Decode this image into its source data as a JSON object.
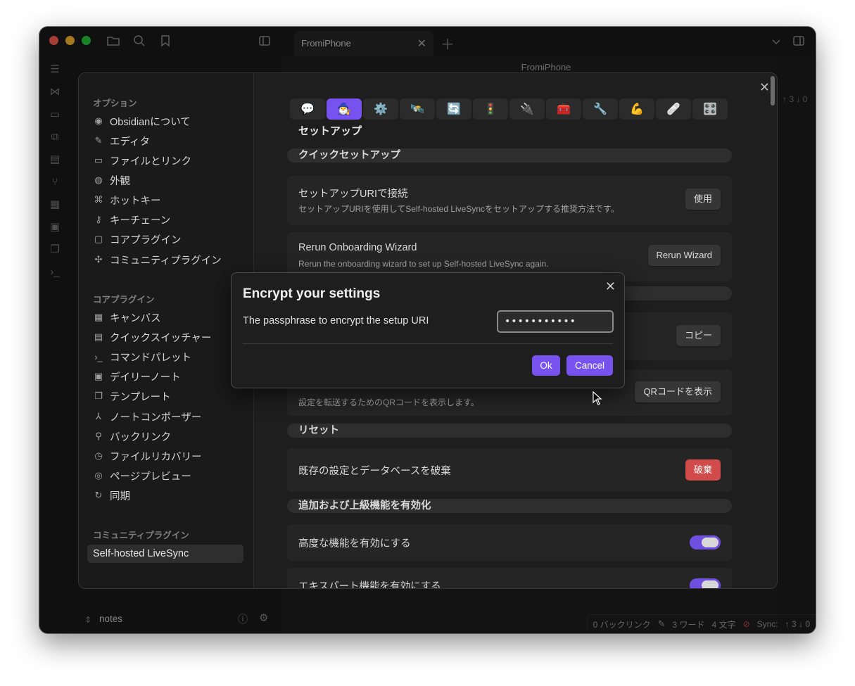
{
  "window": {
    "tab_title": "FromiPhone",
    "view_title": "FromiPhone"
  },
  "right_pane": {
    "sync_counts": "↑ 3 ↓ 0"
  },
  "vault": {
    "name": "notes"
  },
  "statusbar": {
    "backlinks": "0 バックリンク",
    "words": "3 ワード",
    "chars": "4 文字",
    "sync_label": "Sync:",
    "sync_counts": "↑ 3 ↓ 0"
  },
  "settings": {
    "sidebar": {
      "group_options": "オプション",
      "options": [
        "Obsidianについて",
        "エディタ",
        "ファイルとリンク",
        "外観",
        "ホットキー",
        "キーチェーン",
        "コアプラグイン",
        "コミュニティプラグイン"
      ],
      "group_core": "コアプラグイン",
      "core": [
        "キャンバス",
        "クイックスイッチャー",
        "コマンドパレット",
        "デイリーノート",
        "テンプレート",
        "ノートコンポーザー",
        "バックリンク",
        "ファイルリカバリー",
        "ページプレビュー",
        "同期"
      ],
      "group_community": "コミュニティプラグイン",
      "community_active": "Self-hosted LiveSync"
    },
    "plugin_tabs": [
      "💬",
      "🧙‍♂️",
      "⚙️",
      "🛰️",
      "🔄",
      "🚦",
      "🔌",
      "🧰",
      "🔧",
      "💪",
      "🩹",
      "🎛️"
    ],
    "section_title": "セットアップ",
    "quick_setup_heading": "クイックセットアップ",
    "setup_uri": {
      "title": "セットアップURIで接続",
      "desc": "セットアップURIを使用してSelf-hosted LiveSyncをセットアップする推奨方法です。",
      "button": "使用"
    },
    "rerun": {
      "title": "Rerun Onboarding Wizard",
      "desc": "Rerun the onboarding wizard to set up Self-hosted LiveSync again.",
      "button": "Rerun Wizard"
    },
    "copy_button": "コピー",
    "qr": {
      "desc": "設定を転送するためのQRコードを表示します。",
      "button": "QRコードを表示"
    },
    "reset_heading": "リセット",
    "discard": {
      "title": "既存の設定とデータベースを破棄",
      "button": "破棄"
    },
    "advanced_heading": "追加および上級機能を有効化",
    "advanced_toggle": {
      "title": "高度な機能を有効にする",
      "on": true
    },
    "expert_toggle": {
      "title": "エキスパート機能を有効にする",
      "on": true
    }
  },
  "dialog": {
    "title": "Encrypt your settings",
    "label": "The passphrase to encrypt the setup URI",
    "input_value": "•••••••••••",
    "ok_label": "Ok",
    "cancel_label": "Cancel"
  },
  "colors": {
    "accent": "#7852ee",
    "danger": "#d14b4b",
    "background": "#1e1e1e"
  }
}
